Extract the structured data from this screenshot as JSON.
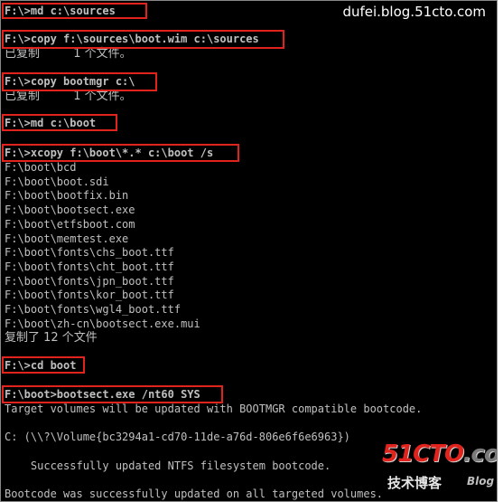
{
  "watermark": "dufei.blog.51cto.com",
  "logo": {
    "main_a": "51CTO",
    "main_b": ".com",
    "sub": "技术博客",
    "blog": "Blog"
  },
  "console": {
    "lines": [
      "F:\\>md c:\\sources",
      "F:\\>copy f:\\sources\\boot.wim c:\\sources",
      "已复制         1 个文件。",
      "F:\\>copy bootmgr c:\\",
      "已复制         1 个文件。",
      "F:\\>md c:\\boot",
      "F:\\>xcopy f:\\boot\\*.* c:\\boot /s",
      "F:\\boot\\bcd",
      "F:\\boot\\boot.sdi",
      "F:\\boot\\bootfix.bin",
      "F:\\boot\\bootsect.exe",
      "F:\\boot\\etfsboot.com",
      "F:\\boot\\memtest.exe",
      "F:\\boot\\fonts\\chs_boot.ttf",
      "F:\\boot\\fonts\\cht_boot.ttf",
      "F:\\boot\\fonts\\jpn_boot.ttf",
      "F:\\boot\\fonts\\kor_boot.ttf",
      "F:\\boot\\fonts\\wgl4_boot.ttf",
      "F:\\boot\\zh-cn\\bootsect.exe.mui",
      "复制了 12 个文件",
      "F:\\>cd boot",
      "F:\\boot>bootsect.exe /nt60 SYS",
      "Target volumes will be updated with BOOTMGR compatible bootcode.",
      "C: (\\\\?\\Volume{bc3294a1-cd70-11de-a76d-806e6f6e6963})",
      "    Successfully updated NTFS filesystem bootcode.",
      "Bootcode was successfully updated on all targeted volumes."
    ]
  }
}
